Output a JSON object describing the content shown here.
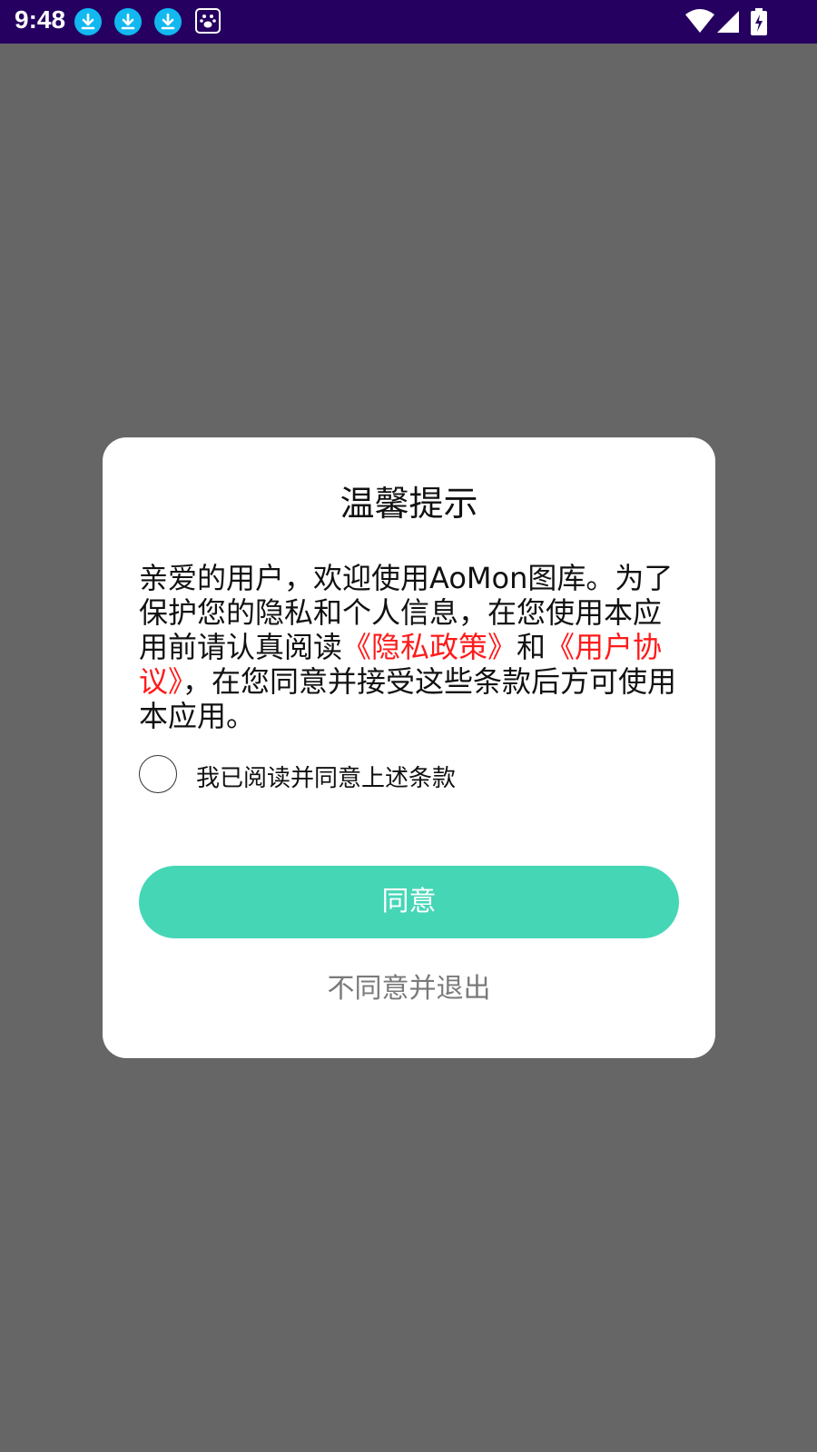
{
  "status_bar": {
    "time": "9:48",
    "notifications": [
      "download-icon",
      "download-icon",
      "download-icon",
      "baidu-paw-icon"
    ],
    "system_icons": [
      "wifi-icon",
      "signal-icon",
      "battery-charging-icon"
    ],
    "background": "#250060"
  },
  "dialog": {
    "title": "温馨提示",
    "body": {
      "intro": "亲爱的用户，欢迎使用AoMon图库。为了保护您的隐私和个人信息，在您使用本应用前请认真阅读",
      "privacy_link": "《隐私政策》",
      "and": "和",
      "user_agreement_link": "《用户协议》",
      "outro": "，在您同意并接受这些条款后方可使用本应用。"
    },
    "checkbox_label": "我已阅读并同意上述条款",
    "checkbox_checked": false,
    "agree_button": "同意",
    "exit_button": "不同意并退出"
  },
  "colors": {
    "overlay": "#666666",
    "accent": "#45d6b6",
    "link": "#ff1a1a",
    "secondary_text": "#7a7a7a"
  }
}
